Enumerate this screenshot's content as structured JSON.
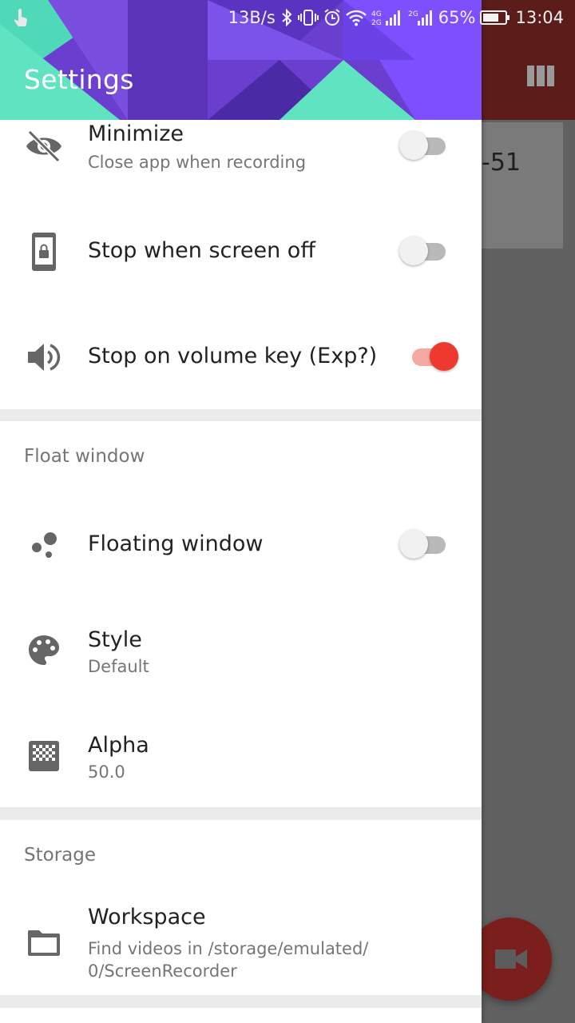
{
  "status_bar": {
    "net_speed": "13B/s",
    "network_4g": "4G 2G",
    "network_2g": "2G",
    "battery": "65%",
    "time": "13:04"
  },
  "background": {
    "card_text": "-51",
    "colors": {
      "appbar": "#5b1c1a",
      "fab": "#7a1f1b",
      "scrim": "#616161"
    }
  },
  "drawer": {
    "title": "Settings",
    "colors": {
      "header_purple": "#6a3fd0",
      "header_teal": "#5fe3c0",
      "accent": "#ee3a2e"
    },
    "general": [
      {
        "icon": "eye-off-icon",
        "title": "Minimize",
        "subtitle": "Close app when recording",
        "toggle": false
      },
      {
        "icon": "phone-lock-icon",
        "title": "Stop when screen off",
        "toggle": false
      },
      {
        "icon": "volume-icon",
        "title": "Stop on volume key (Exp?)",
        "toggle": true
      }
    ],
    "float_window": {
      "label": "Float window",
      "items": [
        {
          "icon": "bubbles-icon",
          "title": "Floating window",
          "toggle": false
        },
        {
          "icon": "palette-icon",
          "title": "Style",
          "subtitle": "Default"
        },
        {
          "icon": "checkerboard-icon",
          "title": "Alpha",
          "subtitle": "50.0"
        }
      ]
    },
    "storage": {
      "label": "Storage",
      "items": [
        {
          "icon": "folder-icon",
          "title": "Workspace",
          "subtitle_line1": "Find videos in /storage/emulated/",
          "subtitle_line2": "0/ScreenRecorder"
        }
      ]
    }
  }
}
